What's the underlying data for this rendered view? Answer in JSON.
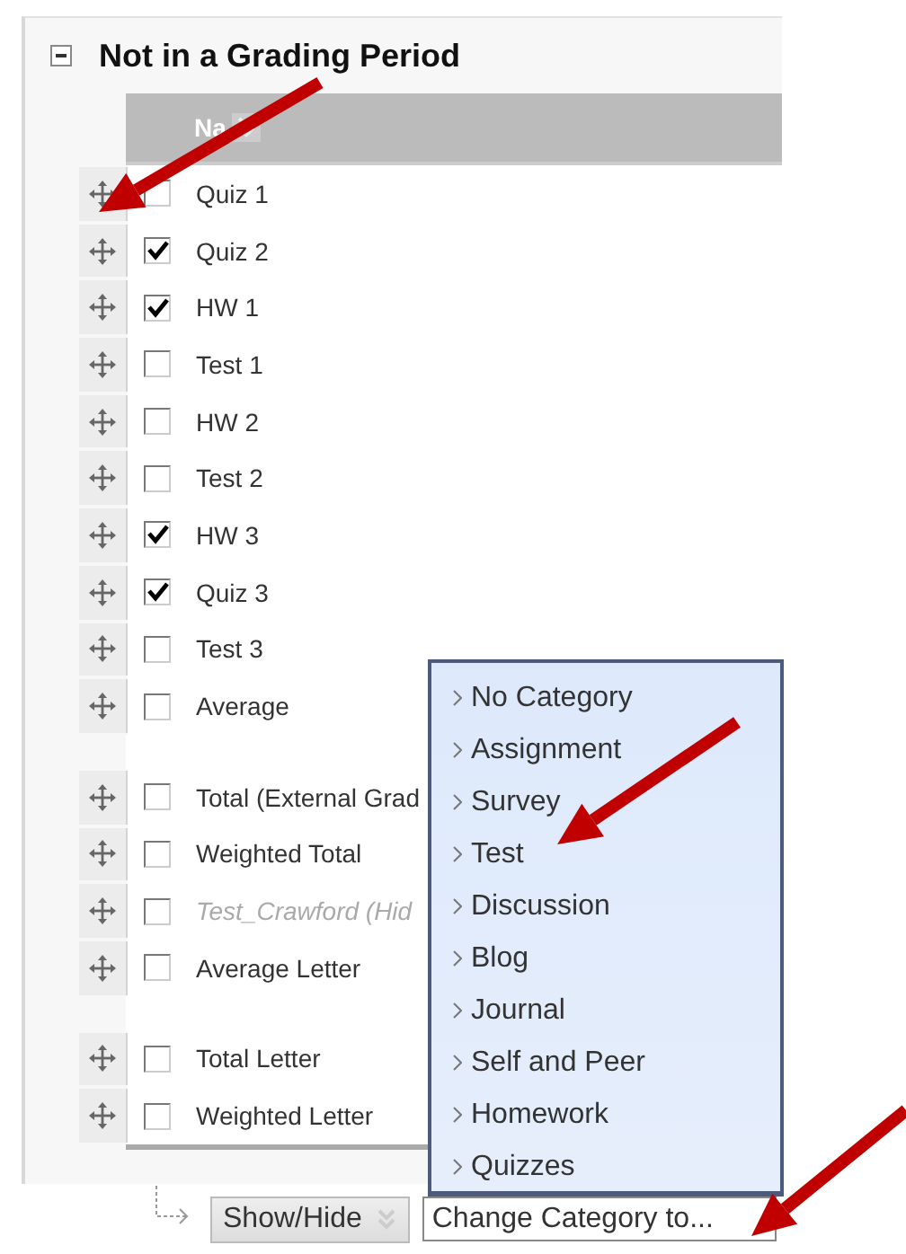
{
  "section": {
    "title": "Not in a Grading Period",
    "expanded": true
  },
  "table": {
    "column": "Na",
    "groups": [
      [
        {
          "name": "Quiz 1",
          "checked": false,
          "hidden": false
        },
        {
          "name": "Quiz 2",
          "checked": true,
          "hidden": false
        },
        {
          "name": "HW 1",
          "checked": true,
          "hidden": false
        },
        {
          "name": "Test 1",
          "checked": false,
          "hidden": false
        },
        {
          "name": "HW 2",
          "checked": false,
          "hidden": false
        },
        {
          "name": "Test 2",
          "checked": false,
          "hidden": false
        },
        {
          "name": "HW 3",
          "checked": true,
          "hidden": false
        },
        {
          "name": "Quiz 3",
          "checked": true,
          "hidden": false
        },
        {
          "name": "Test 3",
          "checked": false,
          "hidden": false
        },
        {
          "name": "Average",
          "checked": false,
          "hidden": false
        }
      ],
      [
        {
          "name": "Total (External Grad",
          "checked": false,
          "hidden": false
        },
        {
          "name": "Weighted Total",
          "checked": false,
          "hidden": false
        },
        {
          "name": "Test_Crawford (Hid",
          "checked": false,
          "hidden": true
        },
        {
          "name": "Average Letter",
          "checked": false,
          "hidden": false
        }
      ],
      [
        {
          "name": "Total Letter",
          "checked": false,
          "hidden": false
        },
        {
          "name": "Weighted Letter",
          "checked": false,
          "hidden": false
        }
      ]
    ]
  },
  "actions": {
    "show_hide": "Show/Hide",
    "change_category": "Change Category to..."
  },
  "category_menu": {
    "items": [
      "No Category",
      "Assignment",
      "Survey",
      "Test",
      "Discussion",
      "Blog",
      "Journal",
      "Self and Peer",
      "Homework",
      "Quizzes"
    ]
  }
}
